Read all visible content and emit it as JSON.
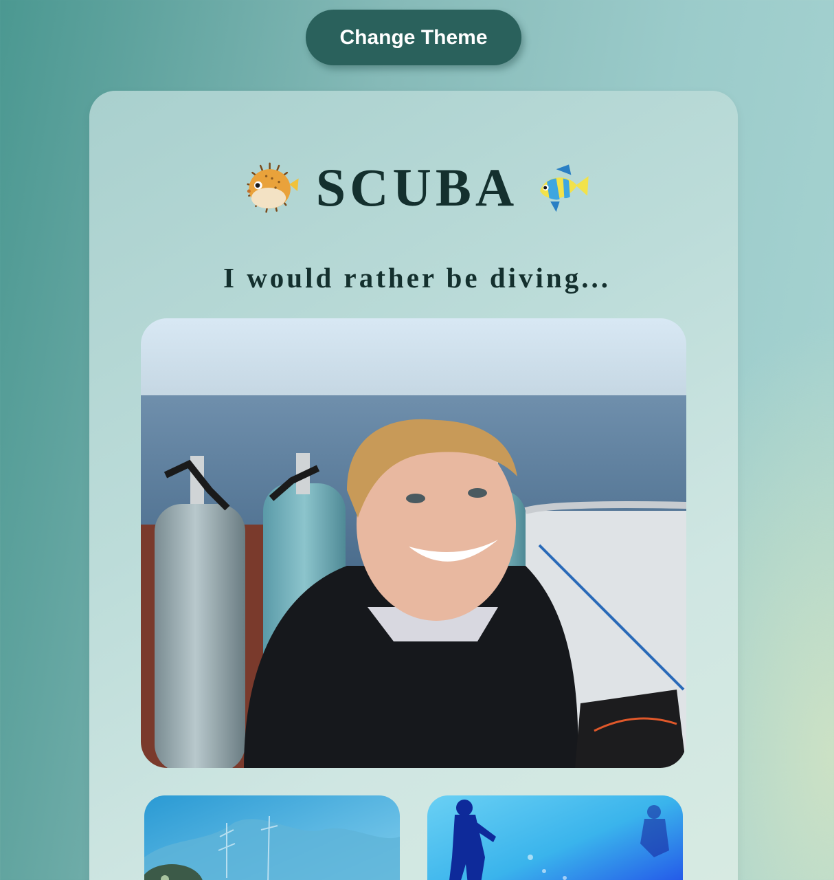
{
  "toolbar": {
    "theme_button_label": "Change Theme"
  },
  "header": {
    "title": "SCUBA",
    "left_icon": "pufferfish-icon",
    "right_icon": "tropical-fish-icon",
    "subtitle": "I would rather be diving..."
  },
  "gallery": {
    "main_photo": "smiling diver on boat deck with scuba tanks and open sea",
    "thumbnails": [
      "coral reef with sea turtle",
      "diver underwater in blue water"
    ]
  },
  "colors": {
    "button": "#2a615c",
    "text": "#14302e",
    "card": "#bcdcd9",
    "background": "#6fa9a5"
  }
}
